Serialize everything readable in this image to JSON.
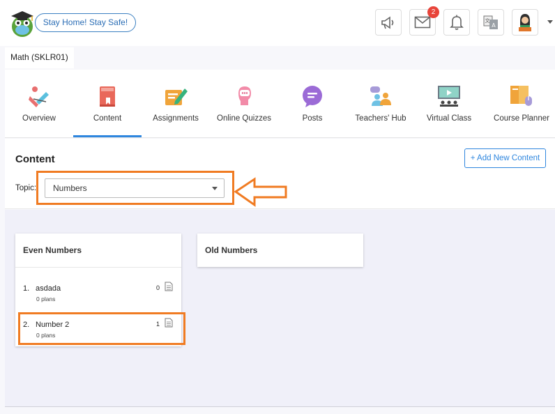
{
  "header": {
    "banner_text": "Stay Home! Stay Safe!",
    "messages_badge": "2",
    "icons": [
      "megaphone-icon",
      "mail-icon",
      "bell-icon",
      "translate-icon",
      "user-avatar"
    ]
  },
  "course": {
    "label": "Math (SKLR01)"
  },
  "nav": {
    "items": [
      {
        "label": "Overview",
        "icon": "overview-icon"
      },
      {
        "label": "Content",
        "icon": "book-icon"
      },
      {
        "label": "Assignments",
        "icon": "assignment-icon"
      },
      {
        "label": "Online Quizzes",
        "icon": "quiz-icon"
      },
      {
        "label": "Posts",
        "icon": "chat-bubble-icon"
      },
      {
        "label": "Teachers' Hub",
        "icon": "people-icon"
      },
      {
        "label": "Virtual Class",
        "icon": "presentation-icon"
      },
      {
        "label": "Course Planner",
        "icon": "planner-icon"
      }
    ],
    "active": "Content"
  },
  "content": {
    "title": "Content",
    "add_button": "+ Add New Content",
    "topic_label": "Topic:",
    "topic_value": "Numbers"
  },
  "cards": [
    {
      "title": "Even Numbers",
      "items": [
        {
          "num": "1.",
          "title": "asdada",
          "sub": "0 plans",
          "count": "0"
        },
        {
          "num": "2.",
          "title": "Number 2",
          "sub": "0 plans",
          "count": "1"
        }
      ]
    },
    {
      "title": "Old Numbers",
      "items": []
    }
  ],
  "colors": {
    "accent": "#2e86de",
    "highlight": "#f07b22",
    "badge": "#e8443a"
  }
}
